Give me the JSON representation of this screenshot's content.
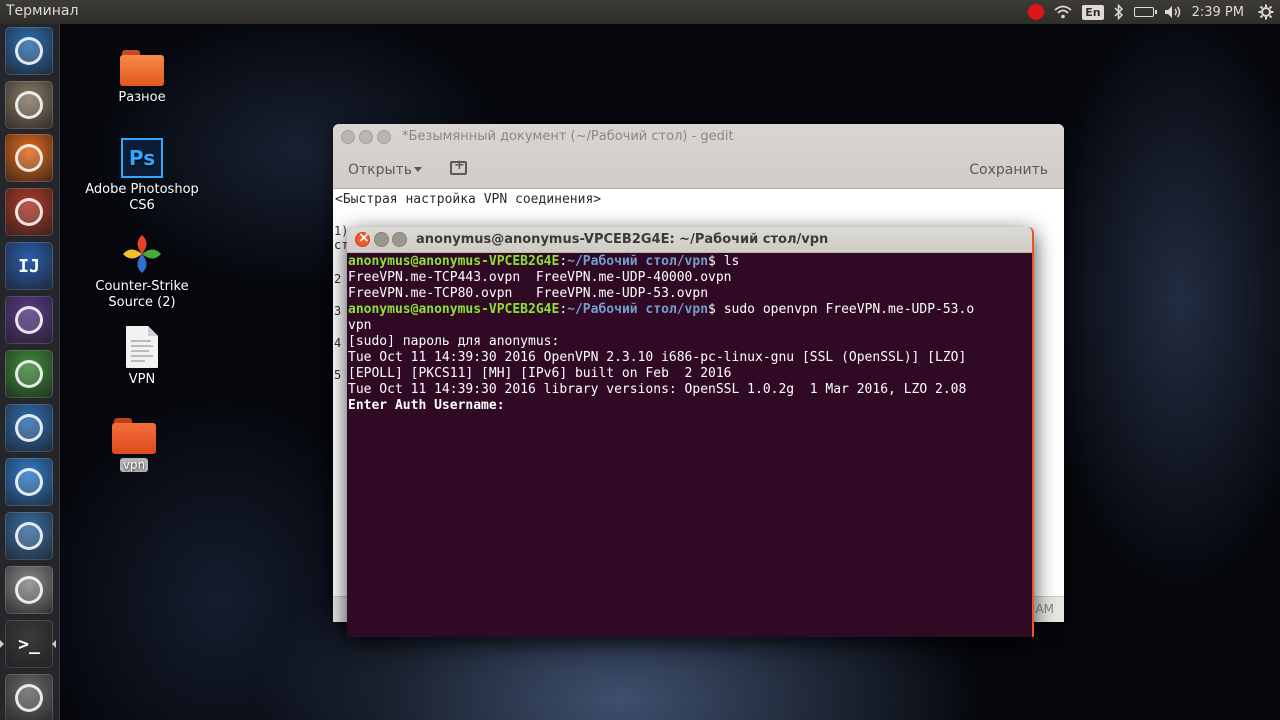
{
  "top_panel": {
    "app_title": "Терминал",
    "keyboard_layout": "En",
    "clock": "2:39 PM"
  },
  "launcher": {
    "items": [
      {
        "name": "ubuntu-dash-icon",
        "color": "#2c6fb3"
      },
      {
        "name": "file-manager-icon",
        "color": "#8a7a66"
      },
      {
        "name": "firefox-icon",
        "color": "#e86a1c"
      },
      {
        "name": "system-settings-icon",
        "color": "#b33a2a"
      },
      {
        "name": "intellij-icon",
        "color": "#2a5fb0",
        "glyph": "IJ"
      },
      {
        "name": "eclipse-icon",
        "color": "#5a3b8c"
      },
      {
        "name": "network-globe-icon",
        "color": "#3e8f3a"
      },
      {
        "name": "water-drop-icon",
        "color": "#2f6fb5"
      },
      {
        "name": "chromium-icon",
        "color": "#2f7fd0"
      },
      {
        "name": "screenshot-tool-icon",
        "color": "#3a6fa8"
      },
      {
        "name": "text-editor-icon",
        "color": "#8a8a8a"
      },
      {
        "name": "terminal-icon",
        "color": "#3b3b3b",
        "glyph": ">_"
      },
      {
        "name": "trash-icon",
        "color": "#6b6b6b"
      }
    ]
  },
  "desktop": {
    "icons": [
      {
        "label": "Разное",
        "type": "folder",
        "color": "#e8602a"
      },
      {
        "label": "Adobe Photoshop CS6",
        "type": "photoshop",
        "glyph": "Ps"
      },
      {
        "label": "Counter-Strike Source (2)",
        "type": "app"
      },
      {
        "label": "VPN",
        "type": "document"
      },
      {
        "label": "vpn",
        "type": "folder",
        "color": "#e8502a"
      }
    ]
  },
  "gedit": {
    "title": "*Безымянный документ (~/Рабочий стол) - gedit",
    "open_label": "Открыть",
    "save_label": "Сохранить",
    "first_line": "<Быстрая настройка VPN соединения>",
    "line_numbers": [
      "1)",
      "ст",
      "2",
      "3",
      "4",
      "5"
    ],
    "status_text": "AM"
  },
  "terminal": {
    "title": "anonymus@anonymus-VPCEB2G4E: ~/Рабочий стол/vpn",
    "prompt_user": "anonymus@anonymus-VPCEB2G4E",
    "prompt_path": "~/Рабочий стол/vpn",
    "cmd1": " ls",
    "ls_row1": "FreeVPN.me-TCP443.ovpn  FreeVPN.me-UDP-40000.ovpn",
    "ls_row2": "FreeVPN.me-TCP80.ovpn   FreeVPN.me-UDP-53.ovpn",
    "cmd2": " sudo openvpn FreeVPN.me-UDP-53.o",
    "cmd2_wrap": "vpn",
    "sudo_prompt": "[sudo] пароль для anonymus:",
    "log1": "Tue Oct 11 14:39:30 2016 OpenVPN 2.3.10 i686-pc-linux-gnu [SSL (OpenSSL)] [LZO]",
    "log2": "[EPOLL] [PKCS11] [MH] [IPv6] built on Feb  2 2016",
    "log3": "Tue Oct 11 14:39:30 2016 library versions: OpenSSL 1.0.2g  1 Mar 2016, LZO 2.08",
    "auth_prompt": "Enter Auth Username:"
  },
  "colors": {
    "terminal_bg": "#300a24",
    "prompt_user": "#8ae234",
    "prompt_path": "#729fcf",
    "accent": "#e95420"
  }
}
